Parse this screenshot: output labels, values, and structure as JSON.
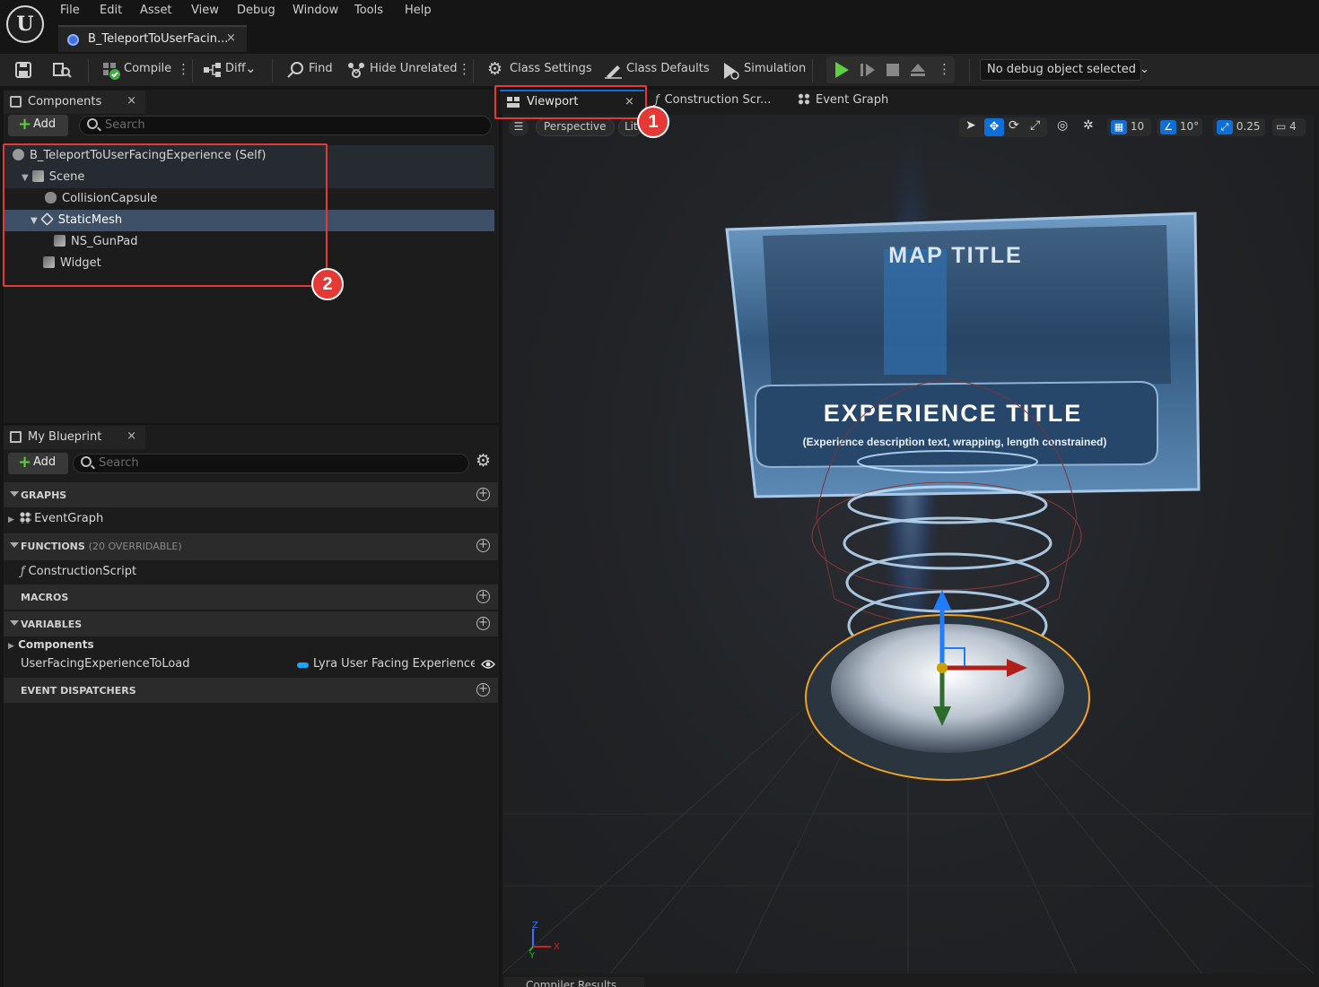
{
  "menu": [
    "File",
    "Edit",
    "Asset",
    "View",
    "Debug",
    "Window",
    "Tools",
    "Help"
  ],
  "document_tab": {
    "label": "B_TeleportToUserFacin...",
    "close": "×"
  },
  "toolbar": {
    "compile": "Compile",
    "diff": "Diff",
    "find": "Find",
    "hide_unrelated": "Hide Unrelated",
    "class_settings": "Class Settings",
    "class_defaults": "Class Defaults",
    "simulation": "Simulation",
    "debug_object": "No debug object selected"
  },
  "components": {
    "tab_label": "Components",
    "close": "×",
    "add_label": "Add",
    "search_placeholder": "Search",
    "tree": [
      {
        "label": "B_TeleportToUserFacingExperience (Self)"
      },
      {
        "label": "Scene"
      },
      {
        "label": "CollisionCapsule"
      },
      {
        "label": "StaticMesh"
      },
      {
        "label": "NS_GunPad"
      },
      {
        "label": "Widget"
      }
    ]
  },
  "my_blueprint": {
    "tab_label": "My Blueprint",
    "close": "×",
    "add_label": "Add",
    "search_placeholder": "Search",
    "graphs_header": "GRAPHS",
    "graph_item": "EventGraph",
    "functions_header": "FUNCTIONS",
    "functions_count": "(20 OVERRIDABLE)",
    "function_item": "ConstructionScript",
    "macros_header": "MACROS",
    "variables_header": "VARIABLES",
    "components_group": "Components",
    "variable_name": "UserFacingExperienceToLoad",
    "variable_type": "Lyra User Facing Experience De",
    "event_dispatchers_header": "EVENT DISPATCHERS"
  },
  "editor_tabs": {
    "viewport": "Viewport",
    "construction": "Construction Scr...",
    "event_graph": "Event Graph",
    "close": "×"
  },
  "viewport_toolbar": {
    "perspective": "Perspective",
    "lit": "Lit",
    "grid_snap": "10",
    "rotation_snap": "10°",
    "scale_snap": "0.25",
    "camera_speed": "4"
  },
  "scene": {
    "map_title": "MAP TITLE",
    "experience_title": "EXPERIENCE TITLE",
    "description": "(Experience description text, wrapping, length constrained)"
  },
  "axis": {
    "x": "X",
    "y": "Y",
    "z": "Z"
  },
  "annotations": {
    "one": "1",
    "two": "2"
  },
  "compiler_results": "Compiler Results",
  "colors": {
    "accent_blue": "#0f6fd8",
    "annotation_red": "#e53935",
    "selection": "#3e5068",
    "play_green": "#5fcf3f"
  }
}
